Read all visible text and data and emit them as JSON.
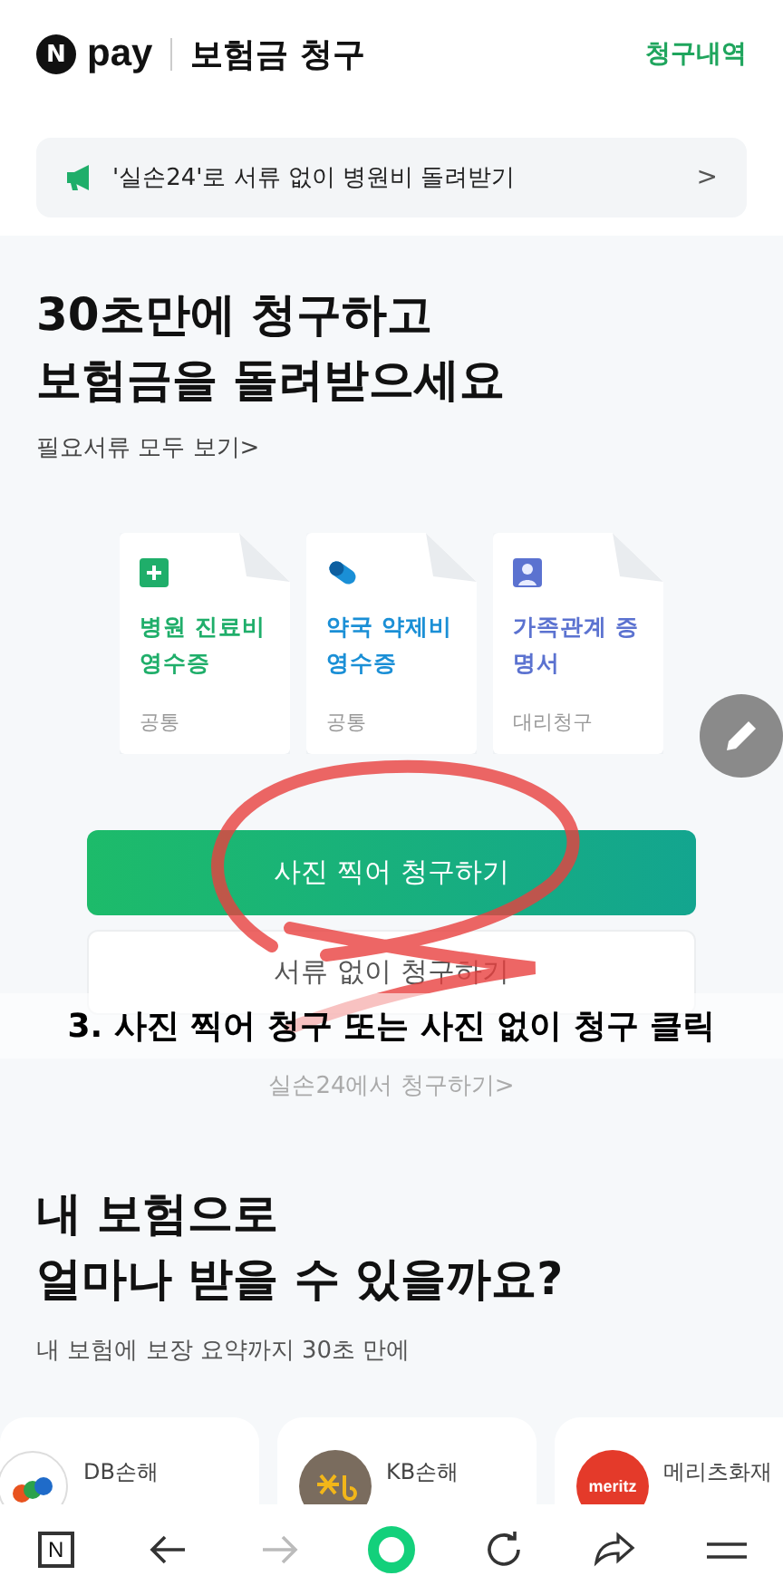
{
  "header": {
    "logo": "pay",
    "logo_mark": "N",
    "title": "보험금 청구",
    "action": "청구내역"
  },
  "banner": {
    "text": "'실손24'로 서류 없이 병원비 돌려받기",
    "chevron": ">"
  },
  "headline": {
    "lines": [
      "30초만에 청구하고",
      "보험금을 돌려받으세요"
    ],
    "link": "필요서류 모두 보기>"
  },
  "documents": [
    {
      "kind": "hospital",
      "title": "병원 진료비 영수증",
      "tag": "공통",
      "color": "#1fae6a"
    },
    {
      "kind": "pharmacy",
      "title": "약국 약제비 영수증",
      "tag": "공통",
      "color": "#1a8fd6"
    },
    {
      "kind": "family",
      "title": "가족관계 증명서",
      "tag": "대리청구",
      "color": "#5b72d0"
    }
  ],
  "buttons": {
    "primary": "사진 찍어 청구하기",
    "secondary": "서류 없이 청구하기",
    "link": "실손24에서 청구하기>"
  },
  "annotation": {
    "caption": "3. 사진 찍어 청구 또는 사진 없이 청구 클릭"
  },
  "section": {
    "lines": [
      "내 보험으로",
      "얼마나 받을 수 있을까요?"
    ],
    "subtitle": "내 보험에 보장 요약까지 30초 만에"
  },
  "insurers": [
    {
      "kind": "db",
      "name": "DB손해"
    },
    {
      "kind": "kb",
      "name": "KB손해"
    },
    {
      "kind": "meritz",
      "name": "메리츠화재",
      "logo_text": "meritz"
    }
  ],
  "nav": {
    "home_mark": "N"
  }
}
